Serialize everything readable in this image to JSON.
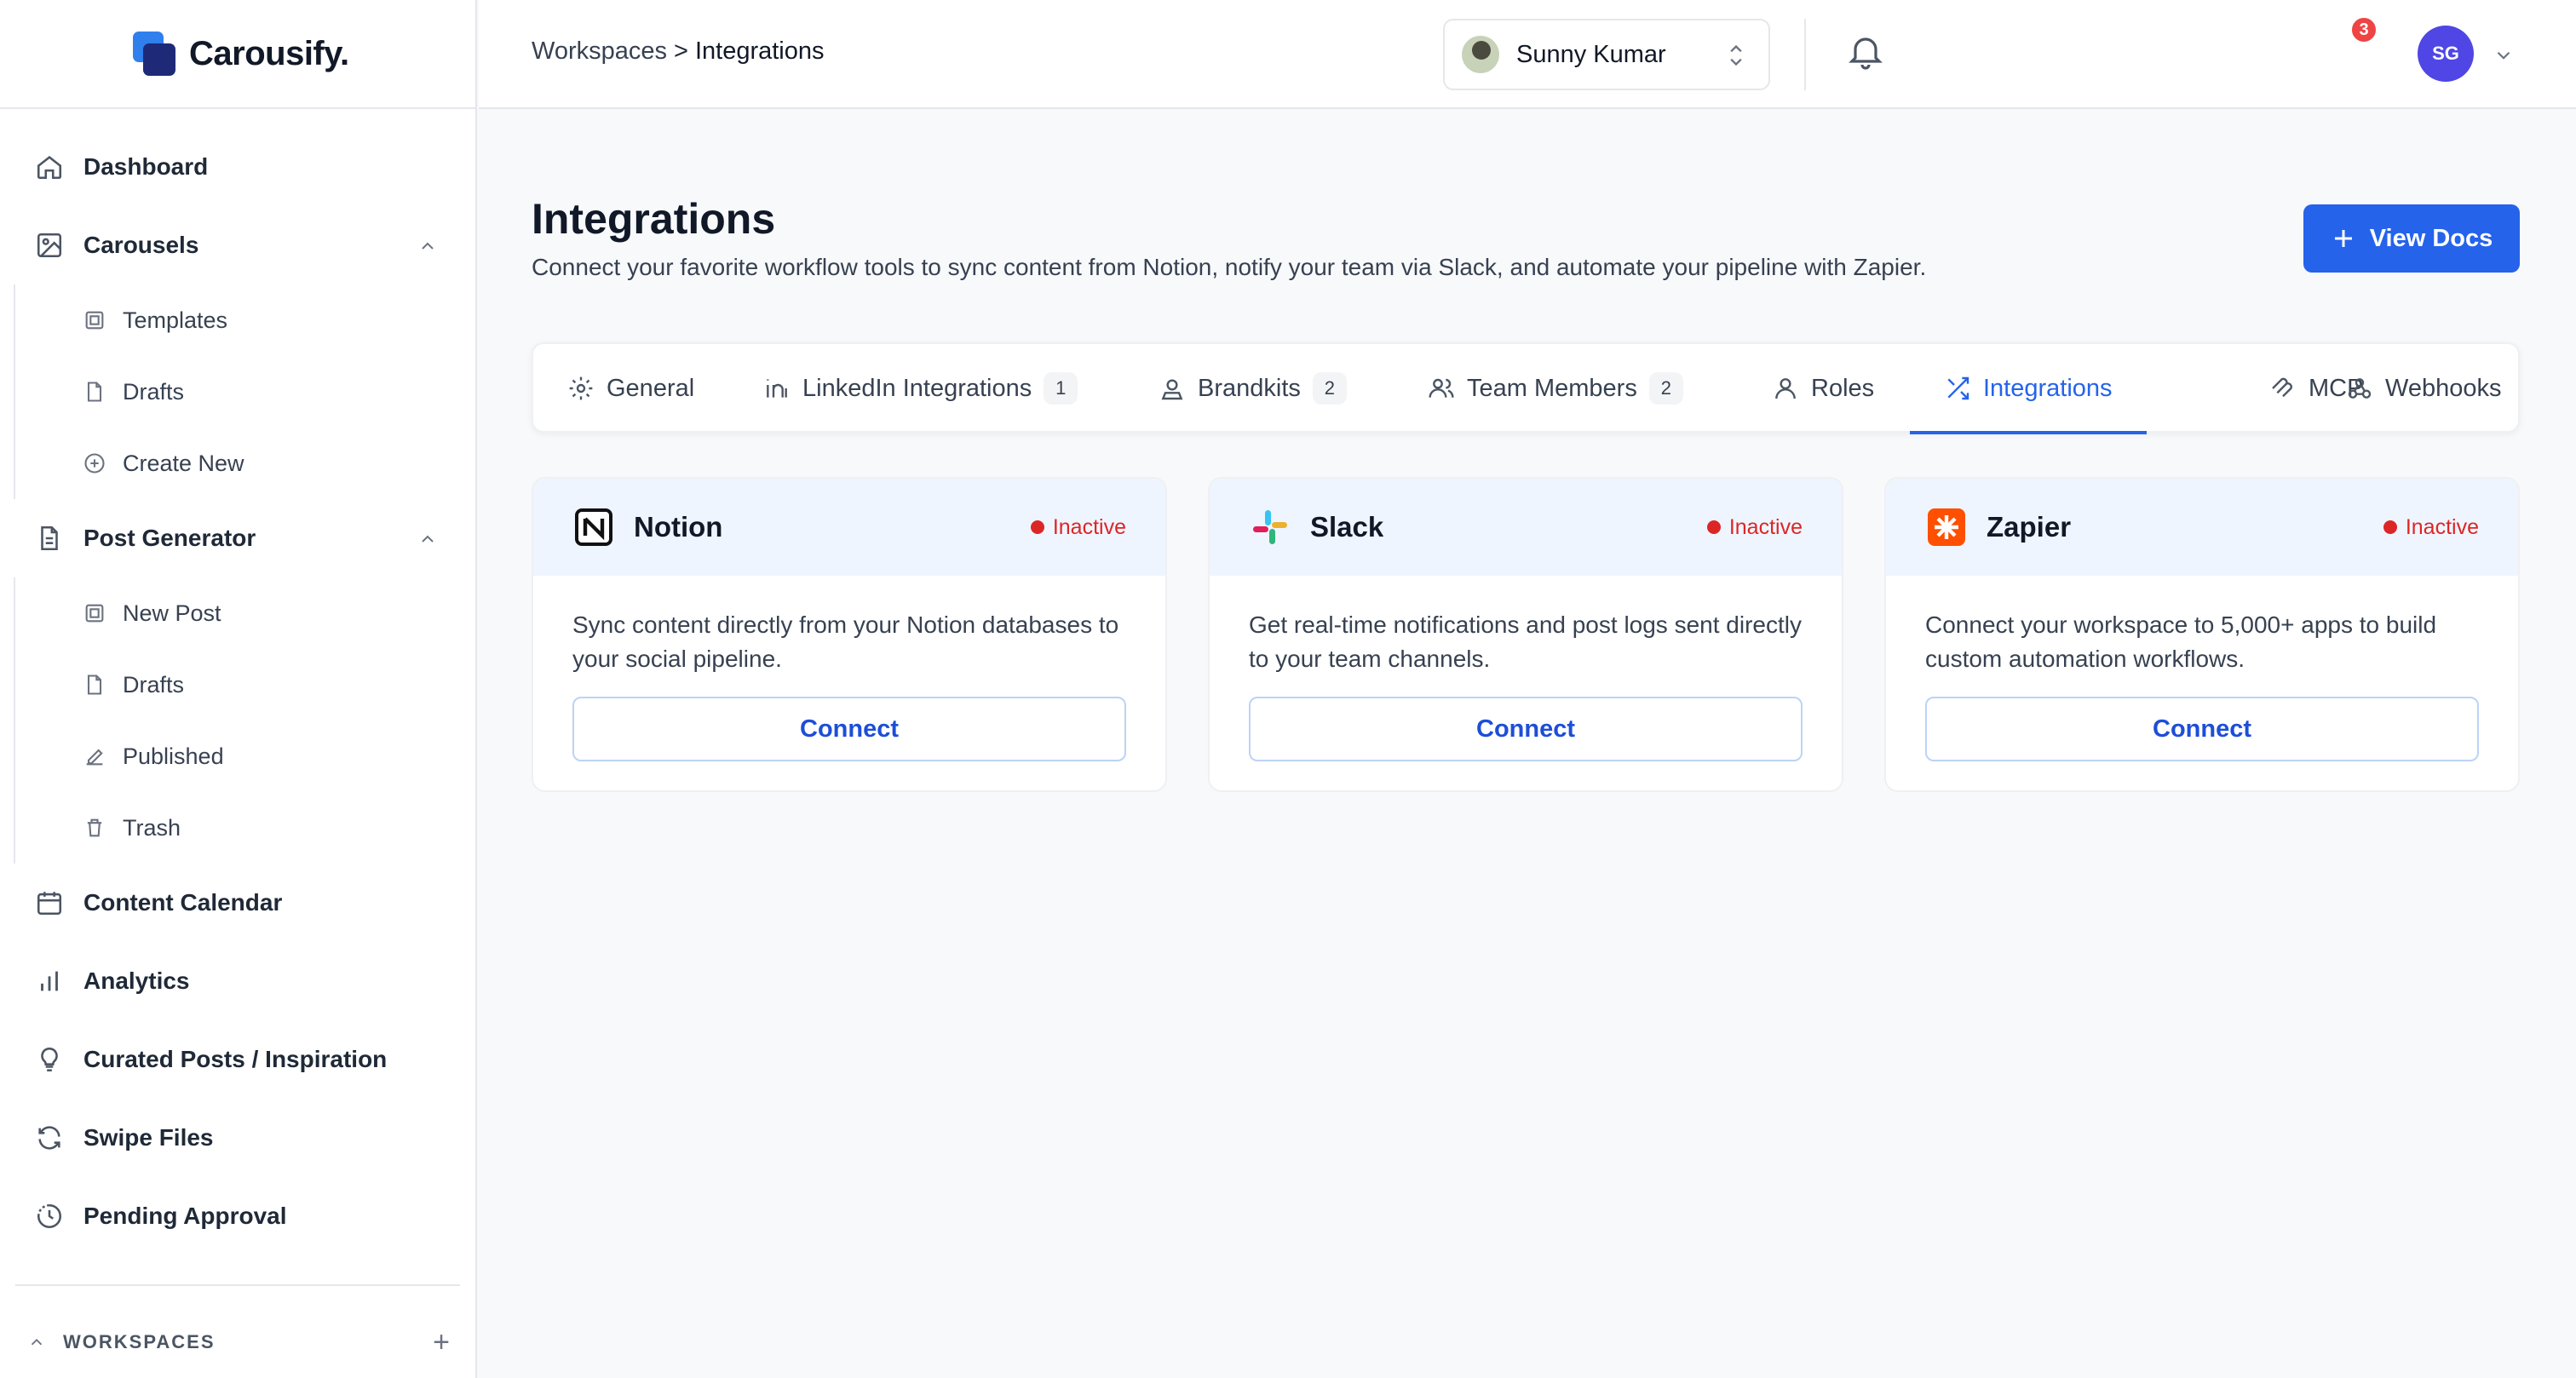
{
  "app": {
    "name": "Carousify."
  },
  "sidebar": {
    "items": [
      {
        "label": "Dashboard",
        "icon": "home-icon"
      },
      {
        "label": "Carousels",
        "icon": "image-icon"
      },
      {
        "label": "Post Generator",
        "icon": "document-icon"
      },
      {
        "label": "Content Calendar",
        "icon": "calendar-icon"
      },
      {
        "label": "Analytics",
        "icon": "bar-chart-icon"
      },
      {
        "label": "Curated Posts / Inspiration",
        "icon": "lightbulb-icon"
      },
      {
        "label": "Swipe Files",
        "icon": "refresh-icon"
      },
      {
        "label": "Pending Approval",
        "icon": "clock-dashed-icon"
      }
    ],
    "carousels_sub": [
      {
        "label": "Templates",
        "icon": "template-icon"
      },
      {
        "label": "Drafts",
        "icon": "file-icon"
      },
      {
        "label": "Create New",
        "icon": "plus-circle-icon"
      }
    ],
    "post_generator_sub": [
      {
        "label": "New Post",
        "icon": "template-icon"
      },
      {
        "label": "Drafts",
        "icon": "file-icon"
      },
      {
        "label": "Published",
        "icon": "pen-icon"
      },
      {
        "label": "Trash",
        "icon": "trash-icon"
      }
    ],
    "workspaces_label": "WORKSPACES",
    "workspaces_add": "+"
  },
  "header": {
    "breadcrumb": [
      "Workspaces",
      "Integrations"
    ],
    "breadcrumb_sep": ">",
    "user_name": "Sunny Kumar",
    "notification_count": "3",
    "avatar_initials": "SG"
  },
  "page": {
    "title": "Integrations",
    "subtitle": "Connect your favorite workflow tools to sync content from Notion, notify your team via Slack, and automate your pipeline with Zapier.",
    "view_docs": "View Docs"
  },
  "tabs": [
    {
      "label": "General",
      "count": ""
    },
    {
      "label": "LinkedIn Integrations",
      "count": "1"
    },
    {
      "label": "Brandkits",
      "count": "2"
    },
    {
      "label": "Team Members",
      "count": "2"
    },
    {
      "label": "Roles",
      "count": ""
    },
    {
      "label": "Integrations",
      "count": "",
      "active": true
    },
    {
      "label": "MCP",
      "count": ""
    },
    {
      "label": "Webhooks",
      "count": ""
    }
  ],
  "integrations": [
    {
      "name": "Notion",
      "status": "Inactive",
      "description": "Sync content directly from your Notion databases to your social pipeline.",
      "action": "Connect"
    },
    {
      "name": "Slack",
      "status": "Inactive",
      "description": "Get real-time notifications and post logs sent directly to your team channels.",
      "action": "Connect"
    },
    {
      "name": "Zapier",
      "status": "Inactive",
      "description": "Connect your workspace to 5,000+ apps to build custom automation workflows.",
      "action": "Connect"
    }
  ],
  "colors": {
    "accent": "#2563eb",
    "inactive": "#dc2626",
    "card_header": "#eff5fe",
    "zapier": "#ff4f00",
    "avatar": "#4f46e5"
  }
}
